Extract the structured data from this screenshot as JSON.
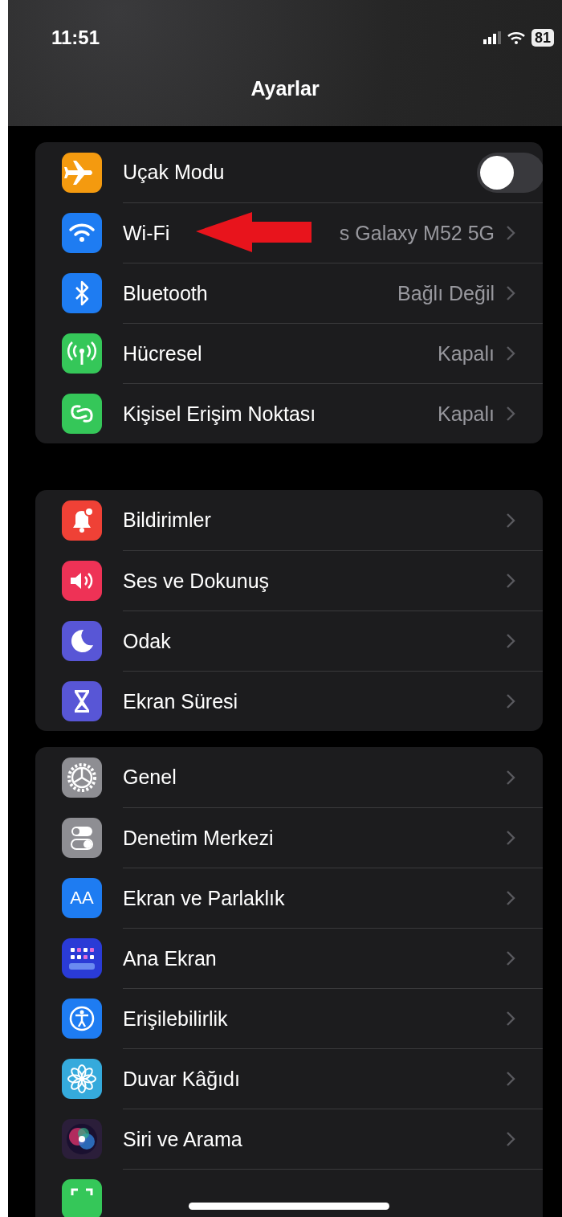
{
  "status_bar": {
    "time": "11:51",
    "battery": "81"
  },
  "title": "Ayarlar",
  "groups": [
    {
      "items": [
        {
          "kind": "toggle",
          "label": "Uçak Modu",
          "color": "#f49a0f",
          "on": false
        },
        {
          "kind": "link",
          "label": "Wi-Fi",
          "value": "s Galaxy M52 5G",
          "color": "#1e7cf2"
        },
        {
          "kind": "link",
          "label": "Bluetooth",
          "value": "Bağlı Değil",
          "color": "#1e7cf2"
        },
        {
          "kind": "link",
          "label": "Hücresel",
          "value": "Kapalı",
          "color": "#35c759"
        },
        {
          "kind": "link",
          "label": "Kişisel Erişim Noktası",
          "value": "Kapalı",
          "color": "#35c759"
        }
      ]
    },
    {
      "items": [
        {
          "kind": "link",
          "label": "Bildirimler",
          "color": "#ef4136"
        },
        {
          "kind": "link",
          "label": "Ses ve Dokunuş",
          "color": "#ee3256"
        },
        {
          "kind": "link",
          "label": "Odak",
          "color": "#5856d6"
        },
        {
          "kind": "link",
          "label": "Ekran Süresi",
          "color": "#5856d6"
        }
      ]
    },
    {
      "items": [
        {
          "kind": "link",
          "label": "Genel",
          "color": "#8e8e93"
        },
        {
          "kind": "link",
          "label": "Denetim Merkezi",
          "color": "#8e8e93"
        },
        {
          "kind": "link",
          "label": "Ekran ve Parlaklık",
          "color": "#1e7cf2",
          "icon_text": "AA"
        },
        {
          "kind": "link",
          "label": "Ana Ekran",
          "color": "#2a3bd6"
        },
        {
          "kind": "link",
          "label": "Erişilebilirlik",
          "color": "#1e7cf2"
        },
        {
          "kind": "link",
          "label": "Duvar Kâğıdı",
          "color": "#35aadc"
        },
        {
          "kind": "link",
          "label": "Siri ve Arama",
          "color": "#2b1e3a"
        },
        {
          "kind": "partial",
          "color": "#35c759"
        }
      ]
    }
  ]
}
